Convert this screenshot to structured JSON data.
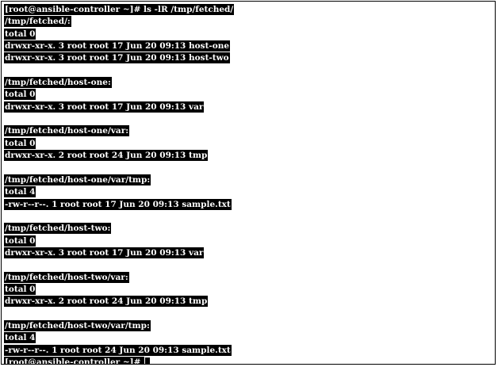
{
  "terminal": {
    "lines": [
      "[root@ansible-controller ~]# ls -lR /tmp/fetched/",
      "/tmp/fetched/:",
      "total 0",
      "drwxr-xr-x. 3 root root 17 Jun 20 09:13 host-one",
      "drwxr-xr-x. 3 root root 17 Jun 20 09:13 host-two",
      "",
      "/tmp/fetched/host-one:",
      "total 0",
      "drwxr-xr-x. 3 root root 17 Jun 20 09:13 var",
      "",
      "/tmp/fetched/host-one/var:",
      "total 0",
      "drwxr-xr-x. 2 root root 24 Jun 20 09:13 tmp",
      "",
      "/tmp/fetched/host-one/var/tmp:",
      "total 4",
      "-rw-r--r--. 1 root root 17 Jun 20 09:13 sample.txt",
      "",
      "/tmp/fetched/host-two:",
      "total 0",
      "drwxr-xr-x. 3 root root 17 Jun 20 09:13 var",
      "",
      "/tmp/fetched/host-two/var:",
      "total 0",
      "drwxr-xr-x. 2 root root 24 Jun 20 09:13 tmp",
      "",
      "/tmp/fetched/host-two/var/tmp:",
      "total 4",
      "-rw-r--r--. 1 root root 24 Jun 20 09:13 sample.txt",
      "[root@ansible-controller ~]# "
    ]
  },
  "colors": {
    "highlight_background": "#000000",
    "highlight_text": "#ffffff",
    "page_background": "#ffffff"
  }
}
